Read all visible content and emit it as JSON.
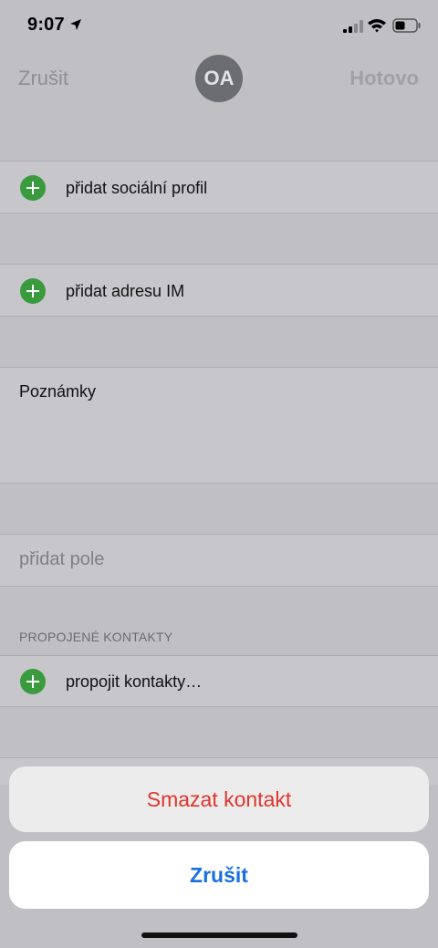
{
  "status": {
    "time": "9:07"
  },
  "nav": {
    "cancel_label": "Zrušit",
    "avatar_initials": "OA",
    "done_label": "Hotovo"
  },
  "rows": {
    "social_profile": "přidat sociální profil",
    "im_address": "přidat adresu IM",
    "notes_label": "Poznámky",
    "add_field": "přidat pole"
  },
  "linked": {
    "header": "PROPOJENÉ KONTAKTY",
    "link_label": "propojit kontakty…"
  },
  "action_sheet": {
    "delete_label": "Smazat kontakt",
    "cancel_label": "Zrušit"
  },
  "colors": {
    "destructive": "#e0352b",
    "accent": "#1a6fe0",
    "add_icon": "#3a9a3e"
  },
  "icons": [
    "location-arrow-icon",
    "cellular-signal-icon",
    "wifi-icon",
    "battery-icon",
    "add-circle-icon"
  ]
}
